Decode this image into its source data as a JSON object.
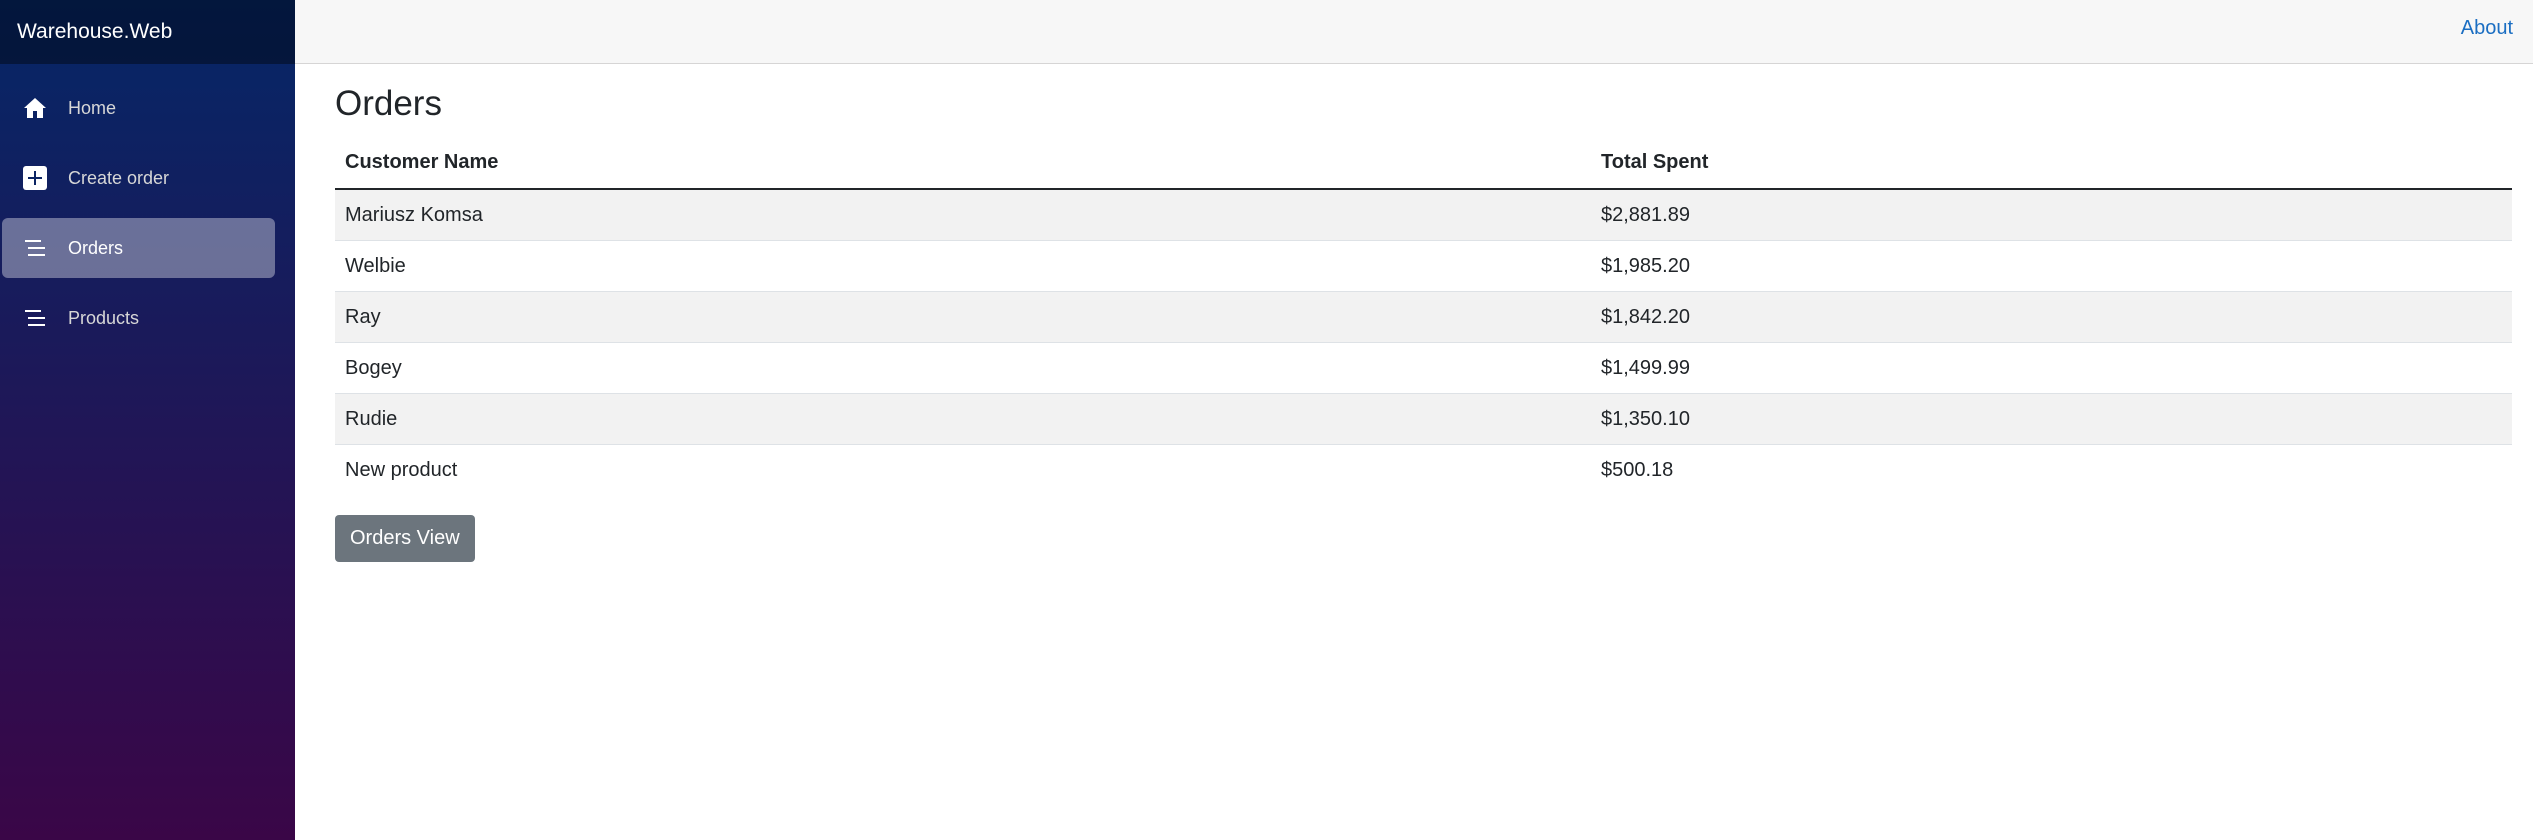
{
  "app": {
    "brand": "Warehouse.Web"
  },
  "sidebar": {
    "items": [
      {
        "label": "Home",
        "icon": "home-icon",
        "active": false
      },
      {
        "label": "Create order",
        "icon": "plus-icon",
        "active": false
      },
      {
        "label": "Orders",
        "icon": "list-icon",
        "active": true
      },
      {
        "label": "Products",
        "icon": "list-icon",
        "active": false
      }
    ]
  },
  "topbar": {
    "about_label": "About"
  },
  "main": {
    "title": "Orders",
    "table": {
      "headers": [
        "Customer Name",
        "Total Spent"
      ],
      "rows": [
        [
          "Mariusz Komsa",
          "$2,881.89"
        ],
        [
          "Welbie",
          "$1,985.20"
        ],
        [
          "Ray",
          "$1,842.20"
        ],
        [
          "Bogey",
          "$1,499.99"
        ],
        [
          "Rudie",
          "$1,350.10"
        ],
        [
          "New product",
          "$500.18"
        ]
      ]
    },
    "button_label": "Orders View"
  },
  "colors": {
    "sidebar_top": "#052767",
    "sidebar_bottom": "#3a0647",
    "link": "#1b6ec2",
    "button": "#6c757d"
  }
}
